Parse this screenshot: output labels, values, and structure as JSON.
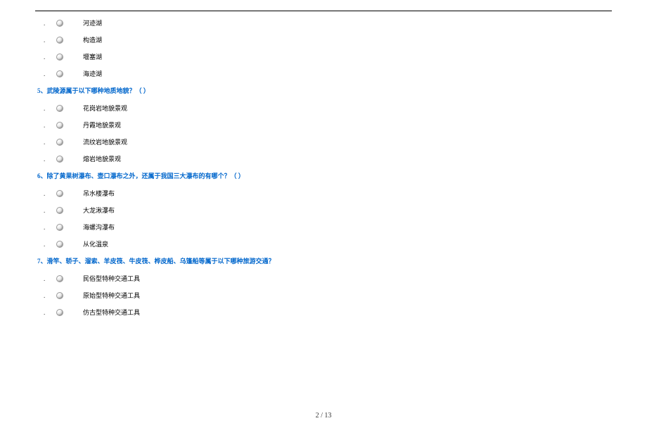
{
  "q_continued": {
    "options": [
      "河迹湖",
      "构造湖",
      "堰塞湖",
      "海迹湖"
    ]
  },
  "q5": {
    "header": "5、武陵源属于以下哪种地质地貌？（   ）",
    "options": [
      "花岗岩地貌景观",
      "丹霞地貌景观",
      "流纹岩地貌景观",
      "熔岩地貌景观"
    ]
  },
  "q6": {
    "header": "6、除了黄果树瀑布、壶口瀑布之外，还属于我国三大瀑布的有哪个？（   ）",
    "options": [
      "吊水楼瀑布",
      "大龙湫瀑布",
      "海螺沟瀑布",
      "从化温泉"
    ]
  },
  "q7": {
    "header": "7、滑竿、轿子、溜索、羊皮筏、牛皮筏、桦皮船、乌篷船等属于以下哪种旅游交通？",
    "options": [
      "民俗型特种交通工具",
      "原始型特种交通工具",
      "仿古型特种交通工具"
    ]
  },
  "footer": {
    "page_current": "2",
    "page_sep": " / ",
    "page_total": "13"
  }
}
